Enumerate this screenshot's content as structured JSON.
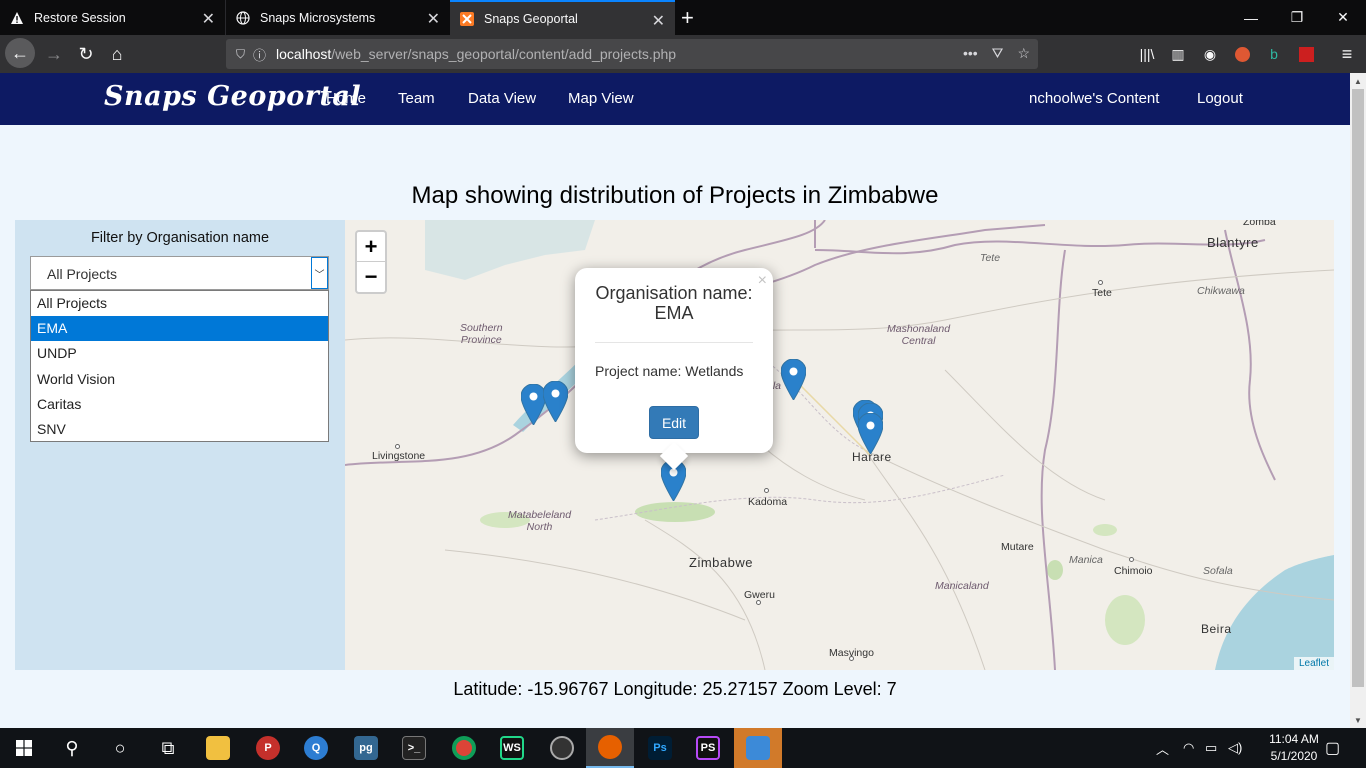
{
  "browser": {
    "tabs": [
      {
        "title": "Restore Session",
        "icon": "warning-icon"
      },
      {
        "title": "Snaps Microsystems",
        "icon": "globe-icon"
      },
      {
        "title": "Snaps Geoportal",
        "icon": "xampp-icon"
      }
    ],
    "url": {
      "host": "localhost",
      "path": "/web_server/snaps_geoportal/content/add_projects.php"
    }
  },
  "site": {
    "brand": "Snaps Geoportal",
    "nav": {
      "home": "Home",
      "team": "Team",
      "data_view": "Data View",
      "map_view": "Map View",
      "content": "nchoolwe's Content",
      "logout": "Logout"
    },
    "colors": {
      "nav_bg": "#0d1a63",
      "panel_bg": "#cfe3f1",
      "selected": "#0078d7",
      "button": "#337ab7"
    }
  },
  "page": {
    "title": "Map showing distribution of Projects in Zimbabwe",
    "filter": {
      "label": "Filter by Organisation name",
      "selected": "All Projects",
      "options": [
        "All Projects",
        "EMA",
        "UNDP",
        "World Vision",
        "Caritas",
        "SNV"
      ],
      "highlighted": "EMA"
    },
    "status": "Latitude: -15.96767 Longitude: 25.27157 Zoom Level: 7"
  },
  "map": {
    "zoom_in": "+",
    "zoom_out": "−",
    "attribution": "Leaflet",
    "places": {
      "zomba": "Zomba",
      "blantyre": "Blantyre",
      "tete_river": "Tete",
      "tete": "Tete",
      "chikwawa": "Chikwawa",
      "southern_province": "Southern\nProvince",
      "mashonaland_central": "Mashonaland\nCentral",
      "livingstone": "Livingstone",
      "harare": "Harare",
      "kadoma": "Kadoma",
      "matabeleland_north": "Matabeleland\nNorth",
      "zimbabwe": "Zimbabwe",
      "mutare": "Mutare",
      "manica": "Manica",
      "chimoio": "Chimoio",
      "sofala": "Sofala",
      "manicaland": "Manicaland",
      "gweru": "Gweru",
      "beira": "Beira",
      "masvingo": "Masvingo",
      "kariba_frag": "ala",
      "kariba_frag2": "t"
    },
    "popup": {
      "org_label": "Organisation name:",
      "org_value": "EMA",
      "project": "Project name: Wetlands",
      "edit": "Edit",
      "close": "×"
    }
  },
  "taskbar": {
    "clock_time": "11:04 AM",
    "clock_date": "5/1/2020"
  }
}
